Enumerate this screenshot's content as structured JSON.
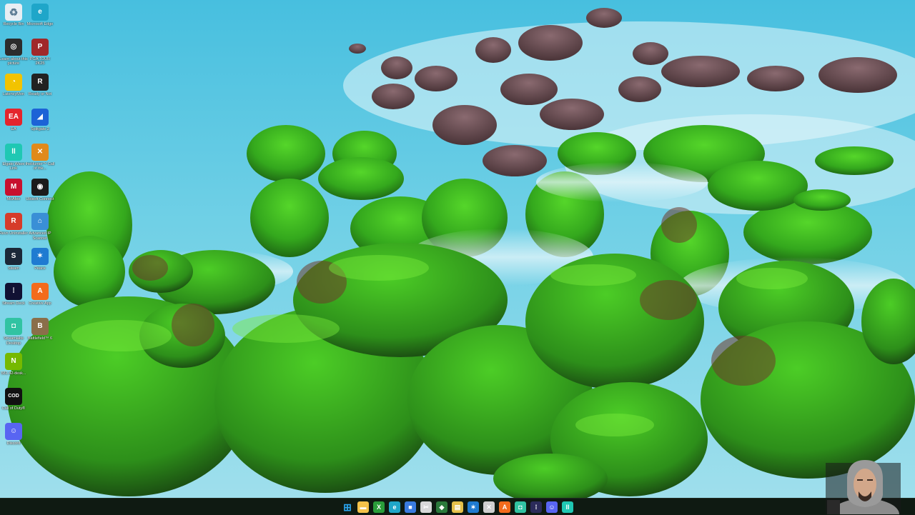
{
  "desktop_icons": [
    {
      "id": "recycle-bin",
      "label": "Recycle Bin",
      "icon": "recycle-bin-icon",
      "color": "#e8eef3",
      "glyph": "♻"
    },
    {
      "id": "microsoft-edge",
      "label": "Microsoft Edge",
      "icon": "edge-icon",
      "color": "#1fa6c9",
      "glyph": "e"
    },
    {
      "id": "learn-about-picture",
      "label": "Learn about this picture",
      "icon": "camera-icon",
      "color": "#2c2c2c",
      "glyph": "◎"
    },
    {
      "id": "pga-tour",
      "label": "PGA TOUR 2K25",
      "icon": "pga-tour-icon",
      "color": "#a0282a",
      "glyph": "P"
    },
    {
      "id": "latencymon",
      "label": "LatencyMon",
      "icon": "latencymon-icon",
      "color": "#f2c300",
      "glyph": "◔"
    },
    {
      "id": "ready-or-not",
      "label": "Ready or Not",
      "icon": "ready-or-not-icon",
      "color": "#222222",
      "glyph": "R"
    },
    {
      "id": "ea",
      "label": "EA",
      "icon": "ea-icon",
      "color": "#e4252c",
      "glyph": "EA"
    },
    {
      "id": "splitgate",
      "label": "Splitgate 2",
      "icon": "splitgate-icon",
      "color": "#1c63d6",
      "glyph": "◢"
    },
    {
      "id": "elgato-wave-link",
      "label": "Elgato Wave Link",
      "icon": "wave-link-icon",
      "color": "#1fc8b3",
      "glyph": "ll"
    },
    {
      "id": "call-of-the-wild",
      "label": "theHunter™ Call of the...",
      "icon": "hunter-icon",
      "color": "#e08a1b",
      "glyph": "✕"
    },
    {
      "id": "mcafee",
      "label": "McAfee",
      "icon": "mcafee-icon",
      "color": "#c8102e",
      "glyph": "M"
    },
    {
      "id": "ubisoft-connect",
      "label": "Ubisoft Connect",
      "icon": "ubisoft-icon",
      "color": "#1b1b1b",
      "glyph": "◉"
    },
    {
      "id": "revo-uninstaller",
      "label": "Revo Uninstaller",
      "icon": "revo-icon",
      "color": "#d63c2a",
      "glyph": "R"
    },
    {
      "id": "advanced-ip-scanner",
      "label": "Advanced IP Scanner",
      "icon": "ip-scanner-icon",
      "color": "#3a8fd6",
      "glyph": "⌂"
    },
    {
      "id": "steam",
      "label": "Steam",
      "icon": "steam-icon",
      "color": "#1b2838",
      "glyph": "S"
    },
    {
      "id": "peace",
      "label": "Peace",
      "icon": "peace-icon",
      "color": "#1f7bd1",
      "glyph": "✶"
    },
    {
      "id": "stream-deck",
      "label": "Stream Deck",
      "icon": "stream-deck-icon",
      "color": "#111133",
      "glyph": "⁞"
    },
    {
      "id": "creative-app",
      "label": "Creative App",
      "icon": "creative-app-icon",
      "color": "#f36b1c",
      "glyph": "A"
    },
    {
      "id": "streamlabs",
      "label": "Streamlabs Desktop",
      "icon": "streamlabs-icon",
      "color": "#31c3a2",
      "glyph": "◘"
    },
    {
      "id": "battlefield-6",
      "label": "Battlefield™ 6",
      "icon": "battlefield-icon",
      "color": "#8a6f4a",
      "glyph": "B"
    },
    {
      "id": "nvidia-driver",
      "label": "581.42-desk...",
      "icon": "nvidia-icon",
      "color": "#76b900",
      "glyph": "N"
    },
    {
      "id": "call-of-duty",
      "label": "Call of Duty®",
      "icon": "call-of-duty-icon",
      "color": "#111111",
      "glyph": "COD"
    },
    {
      "id": "discord",
      "label": "Discord",
      "icon": "discord-icon",
      "color": "#5865f2",
      "glyph": "☺"
    }
  ],
  "taskbar_apps": [
    {
      "name": "start-button",
      "icon": "windows-start-icon",
      "color": "#2aa6f0",
      "glyph": "⊞"
    },
    {
      "name": "file-explorer",
      "icon": "folder-icon",
      "color": "#f4c24a",
      "glyph": "▬"
    },
    {
      "name": "xbox",
      "icon": "xbox-icon",
      "color": "#2a9d3a",
      "glyph": "X"
    },
    {
      "name": "edge",
      "icon": "edge-icon",
      "color": "#1fa6c9",
      "glyph": "e"
    },
    {
      "name": "microsoft-store",
      "icon": "store-icon",
      "color": "#3a7be0",
      "glyph": "■"
    },
    {
      "name": "snipping-tool",
      "icon": "snipping-icon",
      "color": "#d8d8d8",
      "glyph": "✂"
    },
    {
      "name": "game-app",
      "icon": "game-app-icon",
      "color": "#2b7a3b",
      "glyph": "◆"
    },
    {
      "name": "notes",
      "icon": "notes-icon",
      "color": "#e6c14a",
      "glyph": "▤"
    },
    {
      "name": "peace-app",
      "icon": "peace-icon",
      "color": "#1f7bd1",
      "glyph": "✶"
    },
    {
      "name": "tools",
      "icon": "tools-icon",
      "color": "#cfcfcf",
      "glyph": "✕"
    },
    {
      "name": "creative-app",
      "icon": "creative-app-icon",
      "color": "#f36b1c",
      "glyph": "A"
    },
    {
      "name": "streamlabs",
      "icon": "streamlabs-icon",
      "color": "#31c3a2",
      "glyph": "◘"
    },
    {
      "name": "stream-deck",
      "icon": "stream-deck-icon",
      "color": "#2b2b5a",
      "glyph": "⁞"
    },
    {
      "name": "discord",
      "icon": "discord-icon",
      "color": "#5865f2",
      "glyph": "☺"
    },
    {
      "name": "wave-link",
      "icon": "wave-link-icon",
      "color": "#1fc8b3",
      "glyph": "ll"
    }
  ],
  "colors": {
    "sky_top": "#4fc6e4",
    "sky_mid": "#6fd0e6",
    "fog": "#c9ecf3",
    "moss": "#3fbf22",
    "moss_dark": "#1f7a13",
    "rock": "#6a4a4c",
    "taskbar": "#0f1a12"
  }
}
